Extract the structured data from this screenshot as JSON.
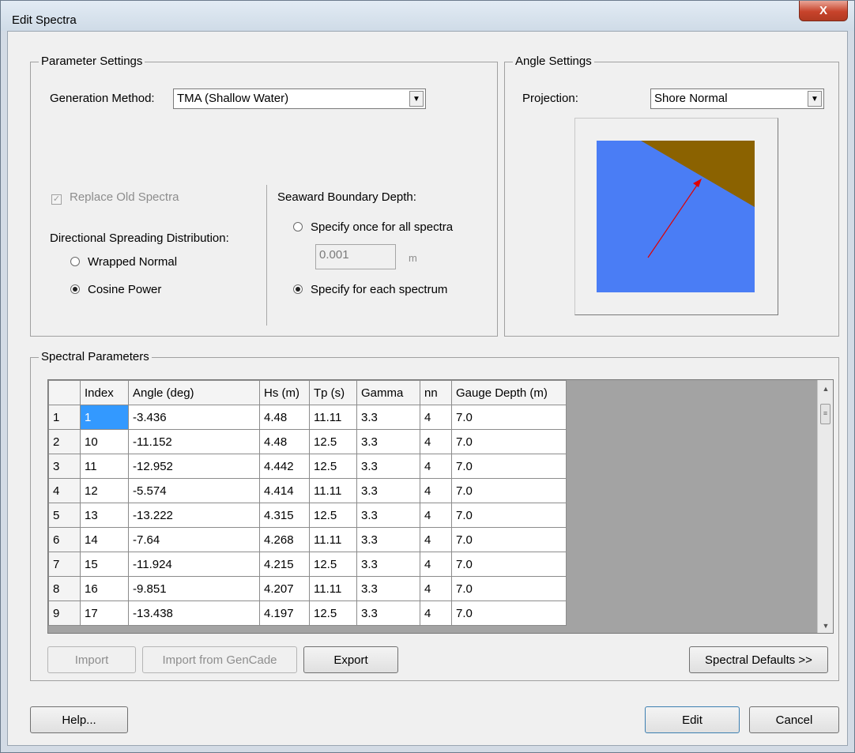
{
  "window": {
    "title": "Edit Spectra",
    "close_glyph": "X"
  },
  "parameter_settings": {
    "legend": "Parameter Settings",
    "generation_method_label": "Generation Method:",
    "generation_method_value": "TMA (Shallow Water)",
    "replace_old_spectra_label": "Replace Old Spectra",
    "replace_old_spectra_checked": true,
    "directional_label": "Directional Spreading Distribution:",
    "wrapped_normal_label": "Wrapped Normal",
    "cosine_power_label": "Cosine Power",
    "directional_selected": "Cosine Power",
    "seaward_label": "Seaward Boundary Depth:",
    "specify_once_label": "Specify once for all spectra",
    "depth_value": "0.001",
    "depth_unit": "m",
    "specify_each_label": "Specify for each spectrum",
    "seaward_selected": "Specify for each spectrum"
  },
  "angle_settings": {
    "legend": "Angle Settings",
    "projection_label": "Projection:",
    "projection_value": "Shore Normal",
    "preview_colors": {
      "water": "#4a7df5",
      "land": "#8b6200",
      "arrow": "#e00000"
    }
  },
  "spectral_parameters": {
    "legend": "Spectral Parameters",
    "columns": [
      "Index",
      "Angle (deg)",
      "Hs (m)",
      "Tp (s)",
      "Gamma",
      "nn",
      "Gauge Depth (m)"
    ],
    "rows": [
      [
        "1",
        "1",
        "-3.436",
        "4.48",
        "11.11",
        "3.3",
        "4",
        "7.0"
      ],
      [
        "2",
        "10",
        "-11.152",
        "4.48",
        "12.5",
        "3.3",
        "4",
        "7.0"
      ],
      [
        "3",
        "11",
        "-12.952",
        "4.442",
        "12.5",
        "3.3",
        "4",
        "7.0"
      ],
      [
        "4",
        "12",
        "-5.574",
        "4.414",
        "11.11",
        "3.3",
        "4",
        "7.0"
      ],
      [
        "5",
        "13",
        "-13.222",
        "4.315",
        "12.5",
        "3.3",
        "4",
        "7.0"
      ],
      [
        "6",
        "14",
        "-7.64",
        "4.268",
        "11.11",
        "3.3",
        "4",
        "7.0"
      ],
      [
        "7",
        "15",
        "-11.924",
        "4.215",
        "12.5",
        "3.3",
        "4",
        "7.0"
      ],
      [
        "8",
        "16",
        "-9.851",
        "4.207",
        "11.11",
        "3.3",
        "4",
        "7.0"
      ],
      [
        "9",
        "17",
        "-13.438",
        "4.197",
        "12.5",
        "3.3",
        "4",
        "7.0"
      ]
    ],
    "import_label": "Import",
    "import_gencade_label": "Import from GenCade",
    "export_label": "Export",
    "spectral_defaults_label": "Spectral Defaults >>"
  },
  "footer": {
    "help_label": "Help...",
    "edit_label": "Edit",
    "cancel_label": "Cancel"
  }
}
